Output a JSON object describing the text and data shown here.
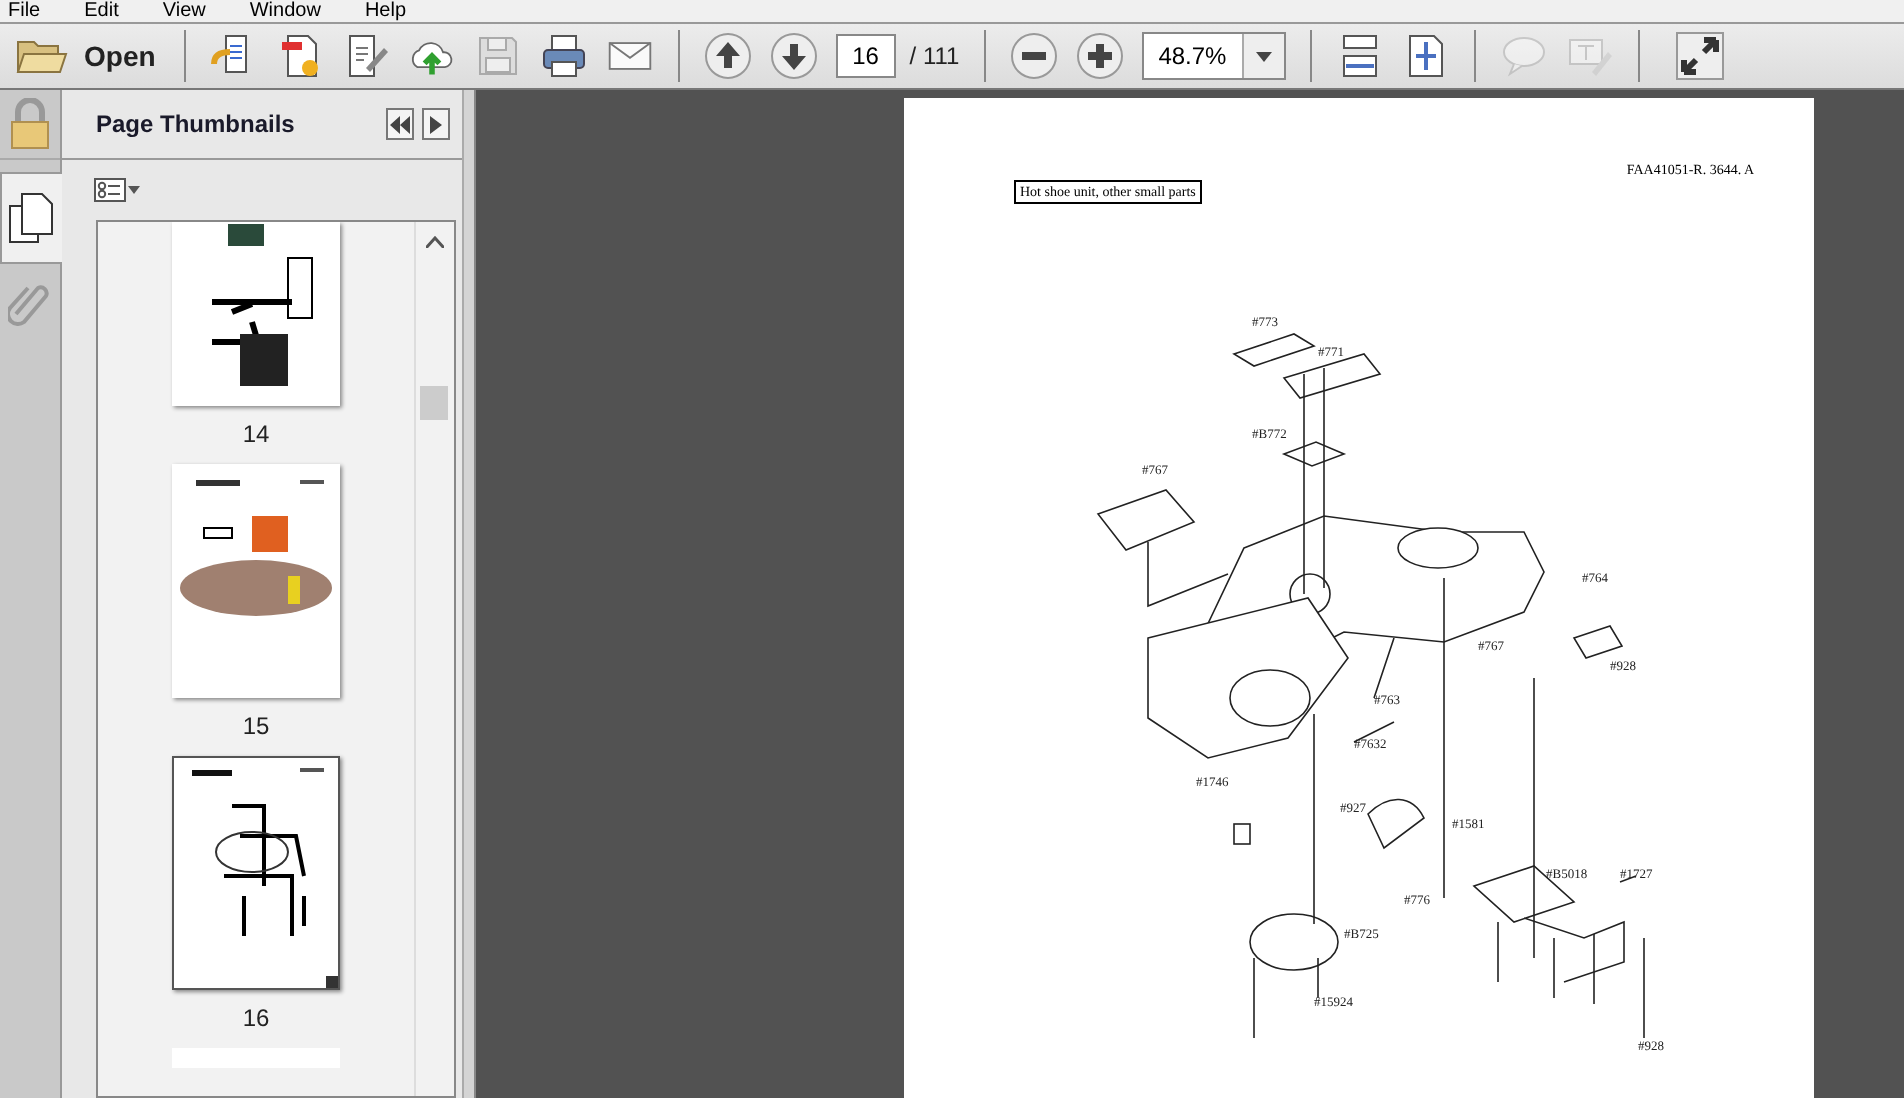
{
  "menu": [
    "File",
    "Edit",
    "View",
    "Window",
    "Help"
  ],
  "toolbar": {
    "open_label": "Open",
    "page_number": "16",
    "page_total": "/ 111",
    "zoom": "48.7%",
    "comment_enabled": false
  },
  "panel": {
    "title": "Page Thumbnails",
    "thumbnails": [
      {
        "label": "14",
        "selected": false
      },
      {
        "label": "15",
        "selected": false
      },
      {
        "label": "16",
        "selected": true
      }
    ]
  },
  "document": {
    "code": "FAA41051-R. 3644. A",
    "title": "Hot shoe unit, other small parts",
    "callouts": [
      "#773",
      "#771",
      "#B772",
      "#767",
      "#764",
      "#767",
      "#928",
      "#763",
      "#7632",
      "#1746",
      "#927",
      "#1581",
      "#B5018",
      "#1727",
      "#776",
      "#B725",
      "#15924",
      "#928"
    ]
  }
}
